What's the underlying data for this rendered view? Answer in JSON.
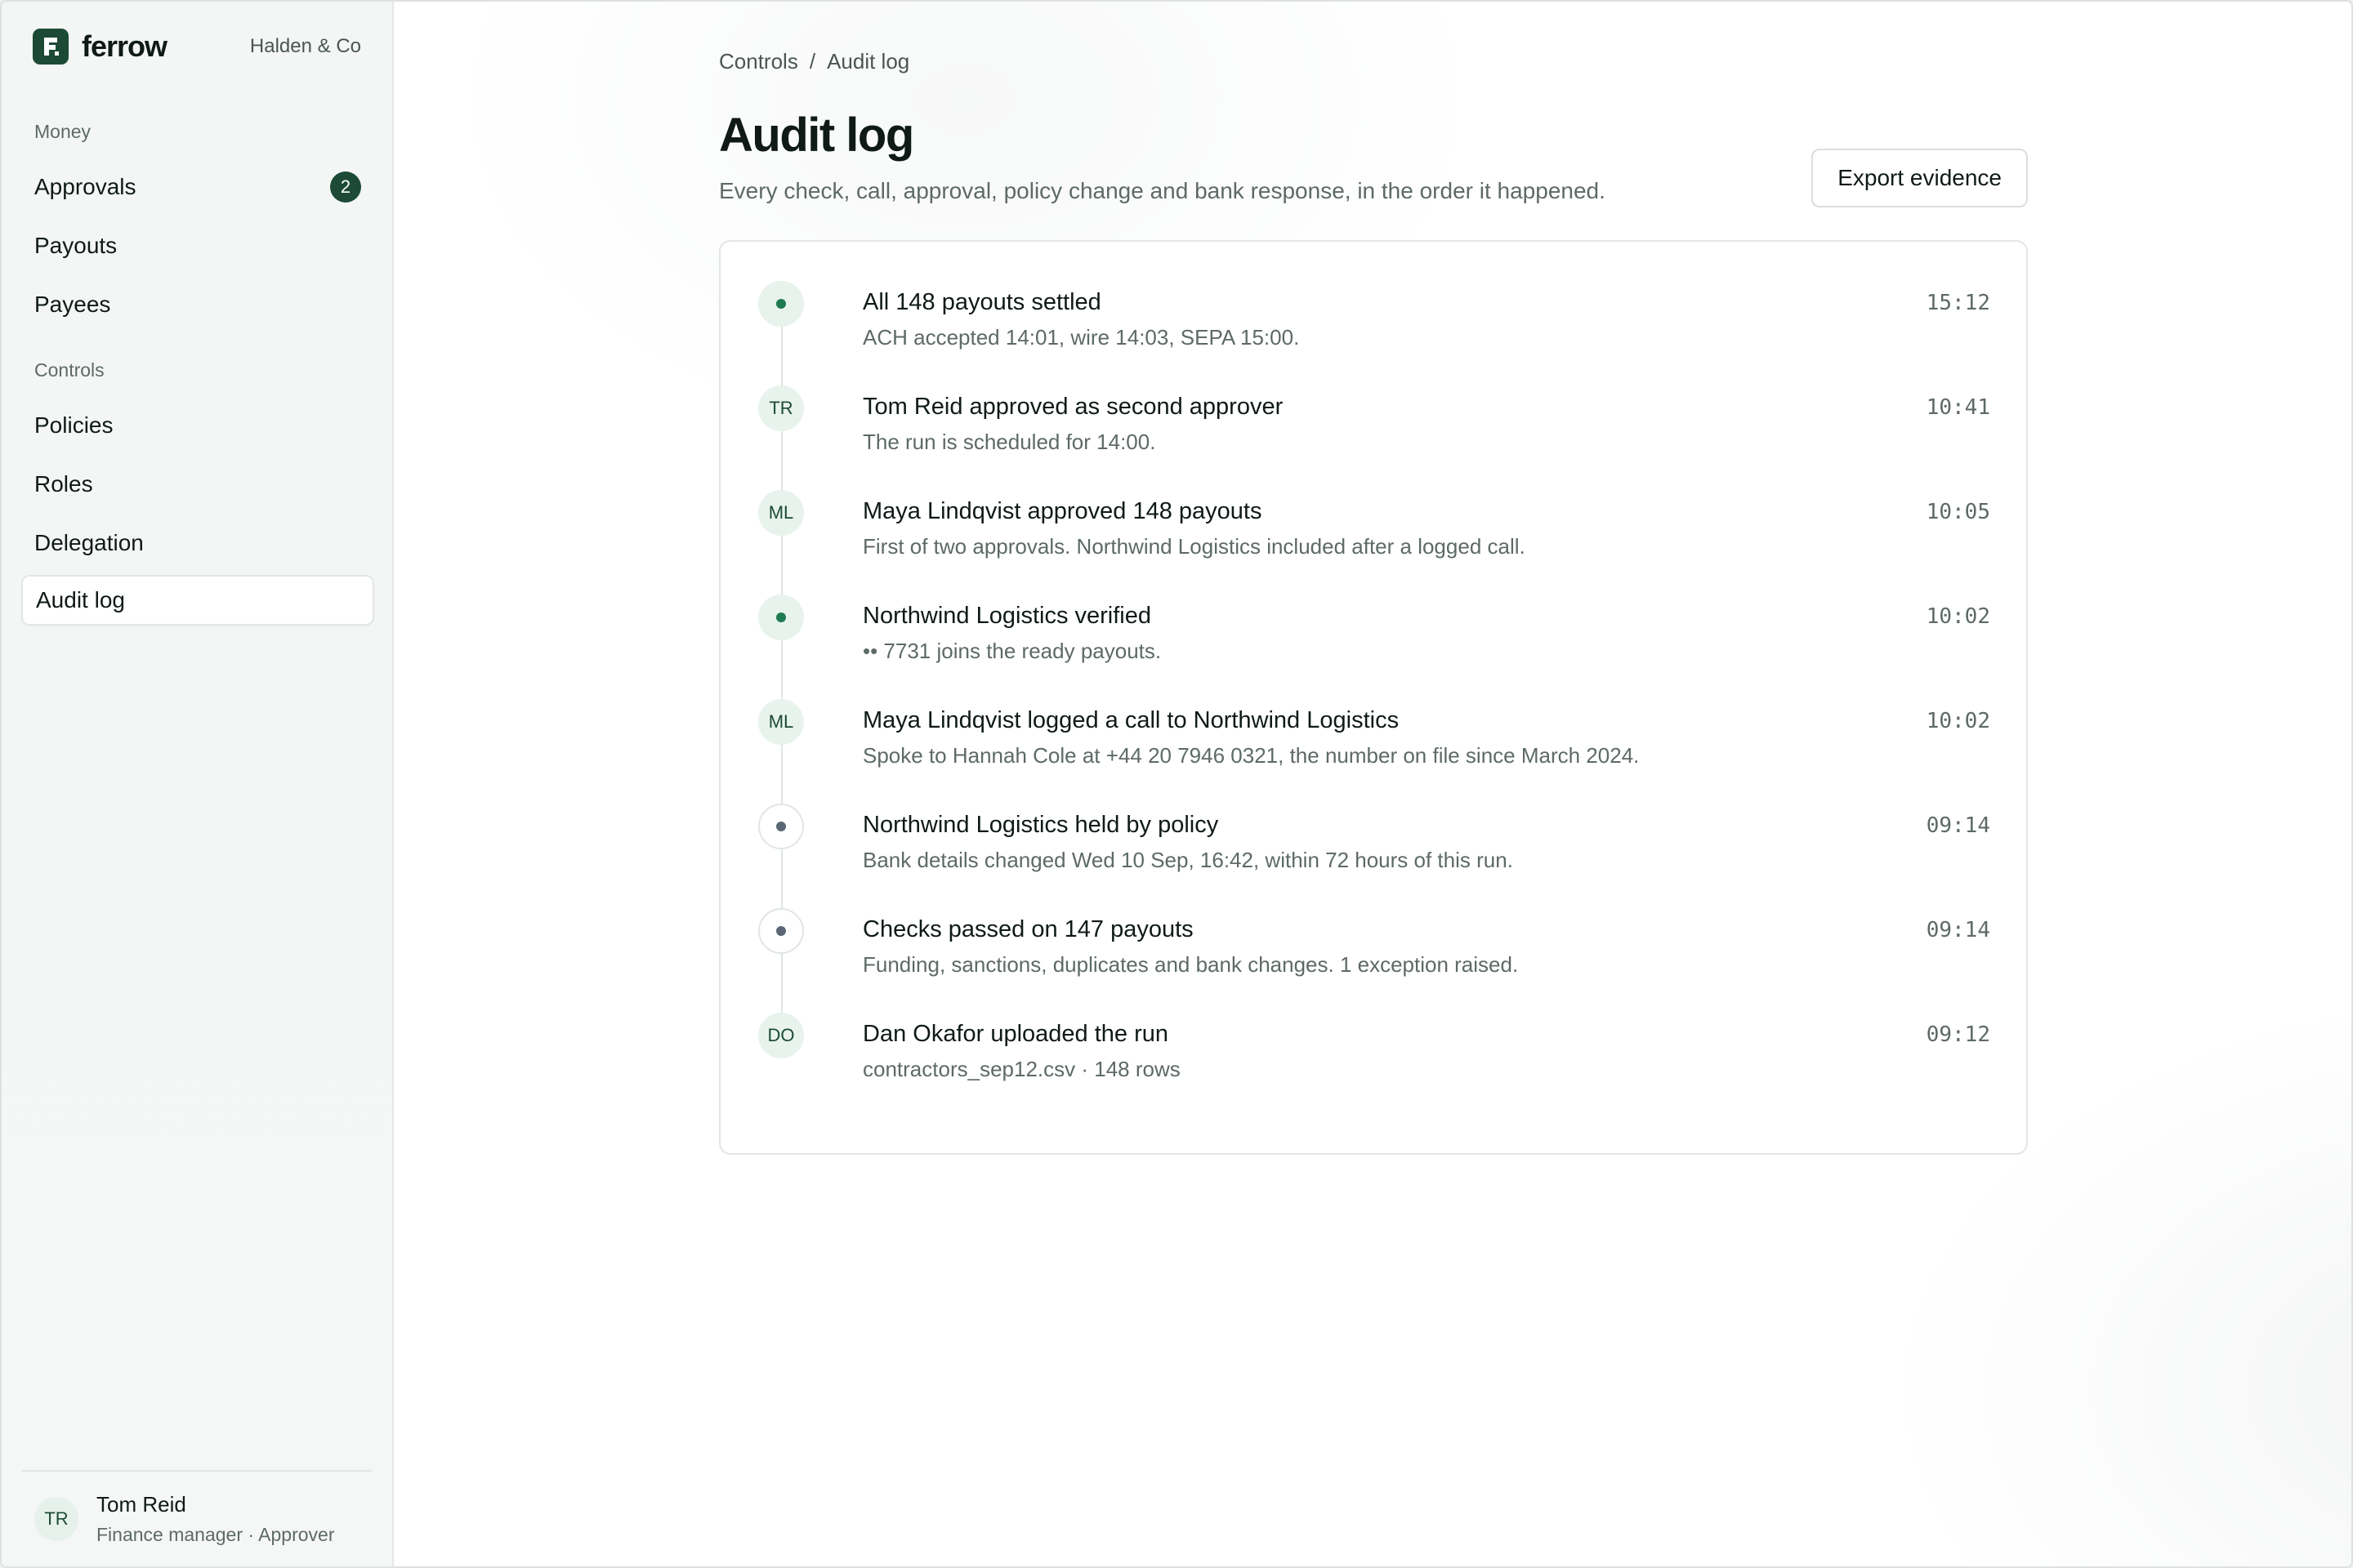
{
  "brand": {
    "name": "ferrow",
    "org": "Halden & Co"
  },
  "sidebar": {
    "sections": [
      {
        "label": "Money"
      },
      {
        "label": "Controls"
      }
    ],
    "items": [
      {
        "label": "Approvals",
        "badge": "2"
      },
      {
        "label": "Payouts"
      },
      {
        "label": "Payees"
      },
      {
        "label": "Policies"
      },
      {
        "label": "Roles"
      },
      {
        "label": "Delegation"
      },
      {
        "label": "Audit log",
        "active": true
      }
    ],
    "user": {
      "initials": "TR",
      "name": "Tom Reid",
      "role": "Finance manager · Approver"
    }
  },
  "header": {
    "breadcrumb": [
      "Controls",
      "/",
      "Audit log"
    ],
    "title": "Audit log",
    "subtitle": "Every check, call, approval, policy change and bank response, in the order it happened.",
    "export_label": "Export evidence"
  },
  "events": [
    {
      "icon": "green-dot-icon",
      "initials": "",
      "title": "All 148 payouts settled",
      "desc": "ACH accepted 14:01, wire 14:03, SEPA 15:00.",
      "time": "15:12"
    },
    {
      "icon": "avatar",
      "initials": "TR",
      "title": "Tom Reid approved as second approver",
      "desc": "The run is scheduled for 14:00.",
      "time": "10:41"
    },
    {
      "icon": "avatar",
      "initials": "ML",
      "title": "Maya Lindqvist approved 148 payouts",
      "desc": "First of two approvals. Northwind Logistics included after a logged call.",
      "time": "10:05"
    },
    {
      "icon": "green-dot-icon",
      "initials": "",
      "title": "Northwind Logistics verified",
      "desc": "•• 7731 joins the ready payouts.",
      "time": "10:02"
    },
    {
      "icon": "avatar",
      "initials": "ML",
      "title": "Maya Lindqvist logged a call to Northwind Logistics",
      "desc": "Spoke to Hannah Cole at +44 20 7946 0321, the number on file since March 2024.",
      "time": "10:02"
    },
    {
      "icon": "grey-dot-icon",
      "initials": "",
      "title": "Northwind Logistics held by policy",
      "desc": "Bank details changed Wed 10 Sep, 16:42, within 72 hours of this run.",
      "time": "09:14"
    },
    {
      "icon": "grey-dot-icon",
      "initials": "",
      "title": "Checks passed on 147 payouts",
      "desc": "Funding, sanctions, duplicates and bank changes. 1 exception raised.",
      "time": "09:14"
    },
    {
      "icon": "avatar",
      "initials": "DO",
      "title": "Dan Okafor uploaded the run",
      "desc": "contractors_sep12.csv · 148 rows",
      "time": "09:12"
    }
  ],
  "colors": {
    "accent": "#1c4a37",
    "success": "#1f7a51",
    "muted": "#5d6a65"
  }
}
